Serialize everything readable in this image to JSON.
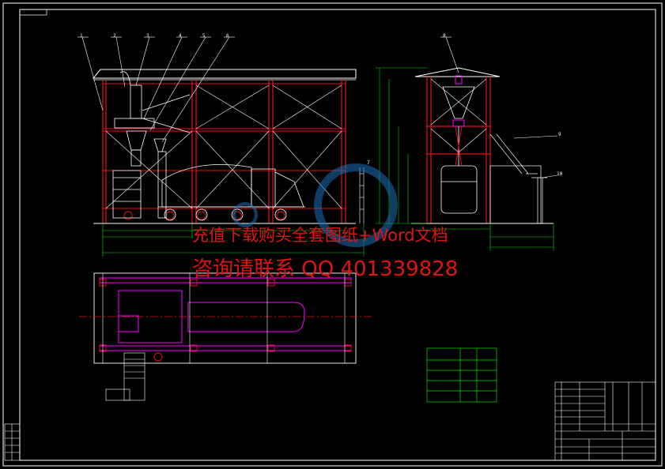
{
  "watermark": {
    "line1": "充值下载购买全套图纸+Word文档",
    "line2": "咨询请联系 QQ 401339828"
  },
  "balloons": [
    "1",
    "2",
    "3",
    "4",
    "5",
    "6",
    "7",
    "8",
    "9",
    "10"
  ],
  "colors": {
    "background": "#000000",
    "frame": "#ffffff",
    "structure": "#e01414",
    "equipment": "#ffffff",
    "dimension": "#00e000",
    "plan_outline": "#ff00ff",
    "centerline": "#e01414",
    "watermark": "#e01414"
  }
}
